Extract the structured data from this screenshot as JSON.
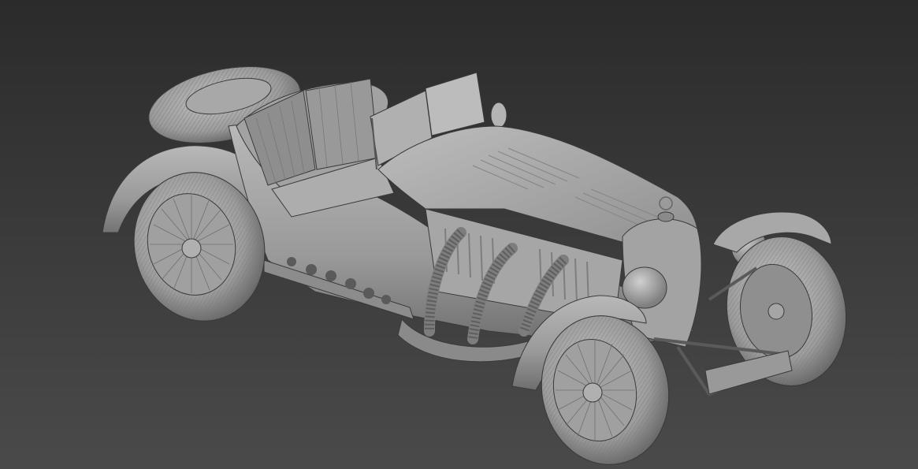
{
  "viewport": {
    "background_top": "#2b2b2b",
    "background_bottom": "#4a4a4a"
  },
  "model": {
    "base_color": "#9a9a9a",
    "highlight_color": "#c4c4c4",
    "shadow_color": "#5e5e5e",
    "outline_color": "#3a3a3a"
  }
}
